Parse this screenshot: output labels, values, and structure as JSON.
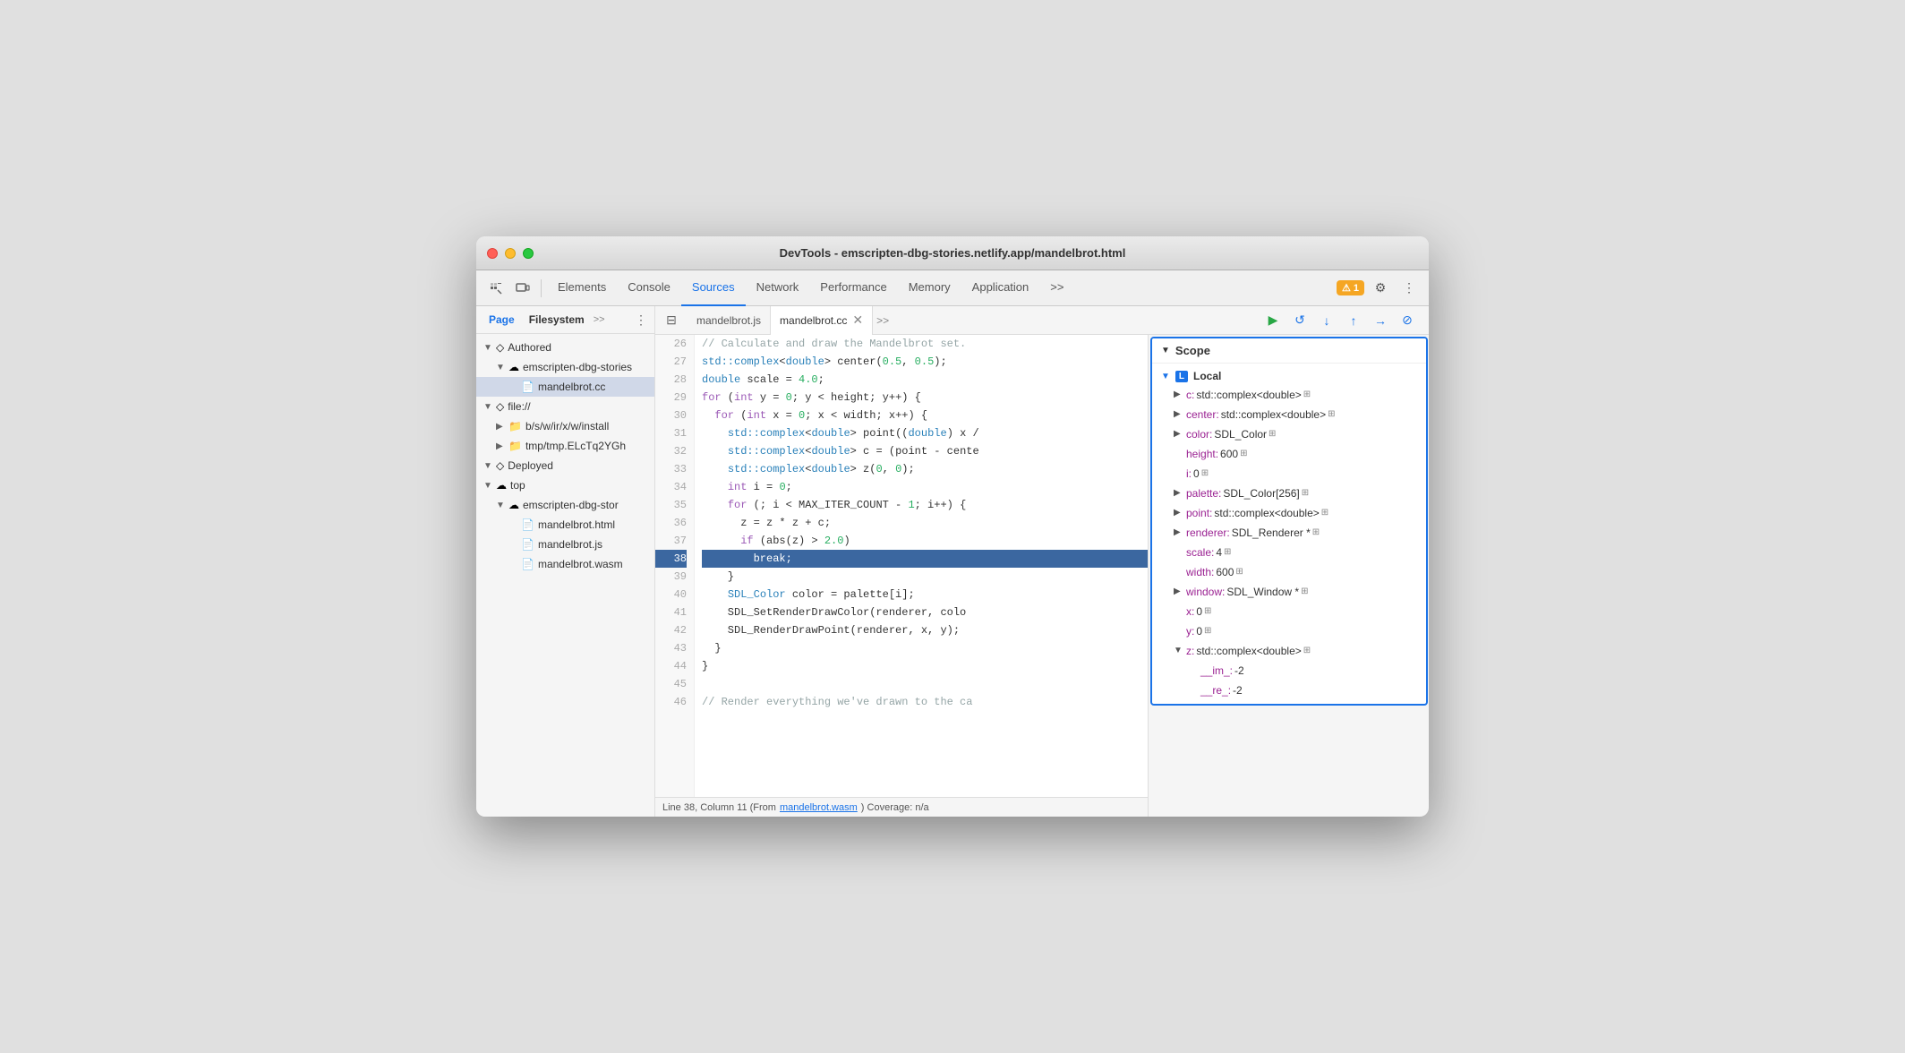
{
  "window": {
    "title": "DevTools - emscripten-dbg-stories.netlify.app/mandelbrot.html"
  },
  "toolbar": {
    "tabs": [
      {
        "label": "Elements",
        "active": false
      },
      {
        "label": "Console",
        "active": false
      },
      {
        "label": "Sources",
        "active": true
      },
      {
        "label": "Network",
        "active": false
      },
      {
        "label": "Performance",
        "active": false
      },
      {
        "label": "Memory",
        "active": false
      },
      {
        "label": "Application",
        "active": false
      }
    ],
    "warning_count": "1",
    "more_tabs_label": ">>"
  },
  "sidebar": {
    "tabs": [
      "Page",
      "Filesystem"
    ],
    "more_label": ">>",
    "tree": [
      {
        "label": "Authored",
        "type": "section",
        "expanded": true,
        "indent": 0
      },
      {
        "label": "emscripten-dbg-stories",
        "type": "cloud-folder",
        "expanded": true,
        "indent": 1
      },
      {
        "label": "mandelbrot.cc",
        "type": "file-cc",
        "indent": 2,
        "selected": true
      },
      {
        "label": "file://",
        "type": "section",
        "expanded": true,
        "indent": 0
      },
      {
        "label": "b/s/w/ir/x/w/install",
        "type": "folder",
        "indent": 1
      },
      {
        "label": "tmp/tmp.ELcTq2YGh",
        "type": "folder",
        "indent": 1
      },
      {
        "label": "Deployed",
        "type": "section",
        "expanded": true,
        "indent": 0
      },
      {
        "label": "top",
        "type": "cloud-folder",
        "expanded": true,
        "indent": 0
      },
      {
        "label": "emscripten-dbg-stor",
        "type": "cloud-subfolder",
        "expanded": true,
        "indent": 1
      },
      {
        "label": "mandelbrot.html",
        "type": "file-html",
        "indent": 2
      },
      {
        "label": "mandelbrot.js",
        "type": "file-js",
        "indent": 2
      },
      {
        "label": "mandelbrot.wasm",
        "type": "file-wasm",
        "indent": 2
      }
    ]
  },
  "editor": {
    "tabs": [
      {
        "label": "mandelbrot.js",
        "active": false,
        "closeable": false
      },
      {
        "label": "mandelbrot.cc",
        "active": true,
        "closeable": true
      }
    ],
    "lines": [
      {
        "num": 29,
        "code": ""
      },
      {
        "num": 26,
        "tokens": [
          {
            "t": "cmt",
            "v": "// Calculate and draw the Mandelbrot set."
          }
        ]
      },
      {
        "num": 27,
        "tokens": [
          {
            "t": "type",
            "v": "std::complex"
          },
          {
            "t": "",
            "v": "<"
          },
          {
            "t": "type",
            "v": "double"
          },
          {
            "t": "",
            "v": "> center("
          },
          {
            "t": "num",
            "v": "0.5"
          },
          {
            "t": "",
            "v": ", "
          },
          {
            "t": "num",
            "v": "0.5"
          },
          {
            "t": "",
            "v": ");"
          }
        ]
      },
      {
        "num": 28,
        "tokens": [
          {
            "t": "type",
            "v": "double"
          },
          {
            "t": "",
            "v": " scale = "
          },
          {
            "t": "num",
            "v": "4.0"
          },
          {
            "t": "",
            "v": ";"
          }
        ]
      },
      {
        "num": 29,
        "tokens": [
          {
            "t": "kw",
            "v": "for"
          },
          {
            "t": "",
            "v": " ("
          },
          {
            "t": "kw",
            "v": "int"
          },
          {
            "t": "",
            "v": " y = "
          },
          {
            "t": "num",
            "v": "0"
          },
          {
            "t": "",
            "v": "; y < height; y++) {"
          }
        ]
      },
      {
        "num": 30,
        "tokens": [
          {
            "t": "kw",
            "v": "  for"
          },
          {
            "t": "",
            "v": " ("
          },
          {
            "t": "kw",
            "v": "int"
          },
          {
            "t": "",
            "v": " x = "
          },
          {
            "t": "num",
            "v": "0"
          },
          {
            "t": "",
            "v": "; x < width; x++) {"
          }
        ]
      },
      {
        "num": 31,
        "tokens": [
          {
            "t": "",
            "v": "    "
          },
          {
            "t": "type",
            "v": "std::complex"
          },
          {
            "t": "",
            "v": "<"
          },
          {
            "t": "type",
            "v": "double"
          },
          {
            "t": "",
            "v": "> point(("
          },
          {
            "t": "type",
            "v": "double"
          },
          {
            "t": "",
            "v": ") x /"
          }
        ]
      },
      {
        "num": 32,
        "tokens": [
          {
            "t": "",
            "v": "    "
          },
          {
            "t": "type",
            "v": "std::complex"
          },
          {
            "t": "",
            "v": "<"
          },
          {
            "t": "type",
            "v": "double"
          },
          {
            "t": "",
            "v": "> c = (point - cente"
          }
        ]
      },
      {
        "num": 33,
        "tokens": [
          {
            "t": "",
            "v": "    "
          },
          {
            "t": "type",
            "v": "std::complex"
          },
          {
            "t": "",
            "v": "<"
          },
          {
            "t": "type",
            "v": "double"
          },
          {
            "t": "",
            "v": "> z("
          },
          {
            "t": "num",
            "v": "0"
          },
          {
            "t": "",
            "v": ", "
          },
          {
            "t": "num",
            "v": "0"
          },
          {
            "t": "",
            "v": ");"
          }
        ]
      },
      {
        "num": 34,
        "tokens": [
          {
            "t": "",
            "v": "    "
          },
          {
            "t": "kw",
            "v": "int"
          },
          {
            "t": "",
            "v": " i = "
          },
          {
            "t": "num",
            "v": "0"
          },
          {
            "t": "",
            "v": ";"
          }
        ]
      },
      {
        "num": 35,
        "tokens": [
          {
            "t": "",
            "v": "    "
          },
          {
            "t": "kw",
            "v": "for"
          },
          {
            "t": "",
            "v": " (; i < MAX_ITER_COUNT - "
          },
          {
            "t": "num",
            "v": "1"
          },
          {
            "t": "",
            "v": "; i++) {"
          }
        ]
      },
      {
        "num": 36,
        "tokens": [
          {
            "t": "",
            "v": "      z = z * z + c;"
          }
        ]
      },
      {
        "num": 37,
        "tokens": [
          {
            "t": "",
            "v": "      "
          },
          {
            "t": "kw",
            "v": "if"
          },
          {
            "t": "",
            "v": " (abs(z) > "
          },
          {
            "t": "num",
            "v": "2.0"
          },
          {
            "t": "",
            "v": ")"
          }
        ]
      },
      {
        "num": 38,
        "tokens": [
          {
            "t": "break-kw",
            "v": "        break"
          },
          {
            "t": "",
            "v": ";"
          }
        ],
        "highlighted": true
      },
      {
        "num": 39,
        "tokens": [
          {
            "t": "",
            "v": "    }"
          }
        ]
      },
      {
        "num": 40,
        "tokens": [
          {
            "t": "",
            "v": "    "
          },
          {
            "t": "type",
            "v": "SDL_Color"
          },
          {
            "t": "",
            "v": " color = palette[i];"
          }
        ]
      },
      {
        "num": 41,
        "tokens": [
          {
            "t": "",
            "v": "    SDL_SetRenderDrawColor(renderer, colo"
          }
        ]
      },
      {
        "num": 42,
        "tokens": [
          {
            "t": "",
            "v": "    SDL_RenderDrawPoint(renderer, x, y);"
          }
        ]
      },
      {
        "num": 43,
        "tokens": [
          {
            "t": "",
            "v": "  }"
          }
        ]
      },
      {
        "num": 44,
        "tokens": [
          {
            "t": "",
            "v": "}"
          }
        ]
      },
      {
        "num": 45,
        "tokens": [
          {
            "t": "",
            "v": ""
          }
        ]
      },
      {
        "num": 46,
        "tokens": [
          {
            "t": "cmt",
            "v": "// Render everything we've drawn to the ca"
          }
        ]
      }
    ]
  },
  "status_bar": {
    "text": "Line 38, Column 11 (From ",
    "link": "mandelbrot.wasm",
    "text2": ") Coverage: n/a"
  },
  "scope": {
    "title": "Scope",
    "section_label": "Local",
    "items": [
      {
        "key": "c:",
        "val": " std::complex<double>",
        "expandable": true
      },
      {
        "key": "center:",
        "val": " std::complex<double>",
        "expandable": true
      },
      {
        "key": "color:",
        "val": " SDL_Color",
        "expandable": true
      },
      {
        "key": "height:",
        "val": " 600",
        "expandable": false
      },
      {
        "key": "i:",
        "val": " 0",
        "expandable": false
      },
      {
        "key": "palette:",
        "val": " SDL_Color[256]",
        "expandable": true
      },
      {
        "key": "point:",
        "val": " std::complex<double>",
        "expandable": true
      },
      {
        "key": "renderer:",
        "val": " SDL_Renderer *",
        "expandable": true
      },
      {
        "key": "scale:",
        "val": " 4",
        "expandable": false
      },
      {
        "key": "width:",
        "val": " 600",
        "expandable": false
      },
      {
        "key": "window:",
        "val": " SDL_Window *",
        "expandable": true
      },
      {
        "key": "x:",
        "val": " 0",
        "expandable": false
      },
      {
        "key": "y:",
        "val": " 0",
        "expandable": false
      },
      {
        "key": "z:",
        "val": " std::complex<double>",
        "expandable": true,
        "expanded": true
      },
      {
        "key": "__im_:",
        "val": " -2",
        "expandable": false,
        "indent": true
      },
      {
        "key": "__re_:",
        "val": " -2",
        "expandable": false,
        "indent": true
      }
    ]
  }
}
